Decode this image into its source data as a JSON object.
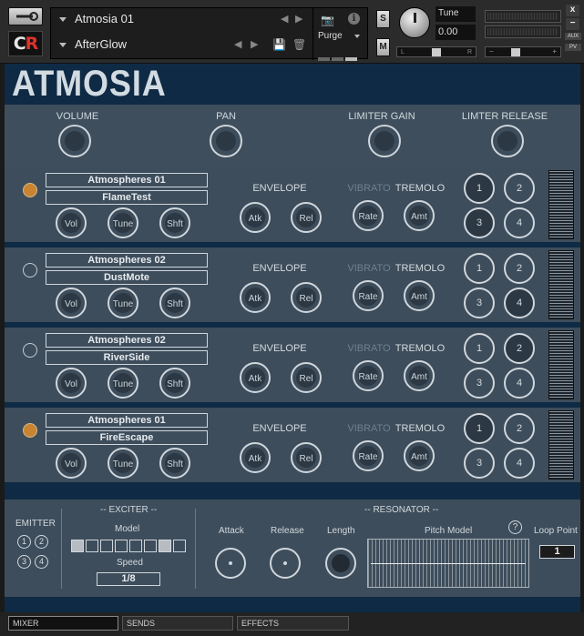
{
  "header": {
    "brand_logo": "CR",
    "instrument_name": "Atmosia 01",
    "preset_name": "AfterGlow",
    "purge_label": "Purge",
    "solo_label": "S",
    "mute_label": "M",
    "tune_label": "Tune",
    "tune_value": "0.00",
    "pan_left": "L",
    "pan_right": "R",
    "vol_minus": "−",
    "vol_plus": "+",
    "close_label": "x",
    "minimize_label": "−",
    "aux_label": "AUX",
    "pv_label": "PV",
    "icons": {
      "tool": "wrench-icon",
      "snapshot": "camera-icon",
      "info": "info-icon",
      "save": "save-icon",
      "delete": "trash-icon"
    }
  },
  "instrument": {
    "title": "ATMOSIA",
    "master": {
      "volume": "VOLUME",
      "pan": "PAN",
      "limiter_gain": "LIMITER GAIN",
      "limiter_release": "LIMTER RELEASE"
    },
    "labels": {
      "envelope": "ENVELOPE",
      "vibrato": "VIBRATO",
      "tremolo": "TREMOLO",
      "vol": "Vol",
      "tune": "Tune",
      "shft": "Shft",
      "atk": "Atk",
      "rel": "Rel",
      "rate": "Rate",
      "amt": "Amt",
      "n1": "1",
      "n2": "2",
      "n3": "3",
      "n4": "4"
    },
    "layers": [
      {
        "category": "Atmospheres 01",
        "sample": "FlameTest",
        "power": true,
        "selected": [
          "1",
          "3"
        ]
      },
      {
        "category": "Atmospheres 02",
        "sample": "DustMote",
        "power": false,
        "selected": [
          "4"
        ]
      },
      {
        "category": "Atmospheres 02",
        "sample": "RiverSide",
        "power": false,
        "selected": [
          "2"
        ]
      },
      {
        "category": "Atmospheres 01",
        "sample": "FireEscape",
        "power": true,
        "selected": [
          "1"
        ]
      }
    ],
    "bottom": {
      "emitter": "EMITTER",
      "exciter": "-- EXCITER --",
      "model": "Model",
      "speed": "Speed",
      "speed_value": "1/8",
      "model_selected": [
        1,
        7
      ],
      "resonator": "-- RESONATOR --",
      "attack": "Attack",
      "release": "Release",
      "length": "Length",
      "pitch_model": "Pitch Model",
      "help": "?",
      "loop_point": "Loop Point",
      "loop_value": "1"
    }
  },
  "tabs": [
    {
      "label": "MIXER",
      "active": true
    },
    {
      "label": "SENDS",
      "active": false
    },
    {
      "label": "EFFECTS",
      "active": false
    }
  ]
}
